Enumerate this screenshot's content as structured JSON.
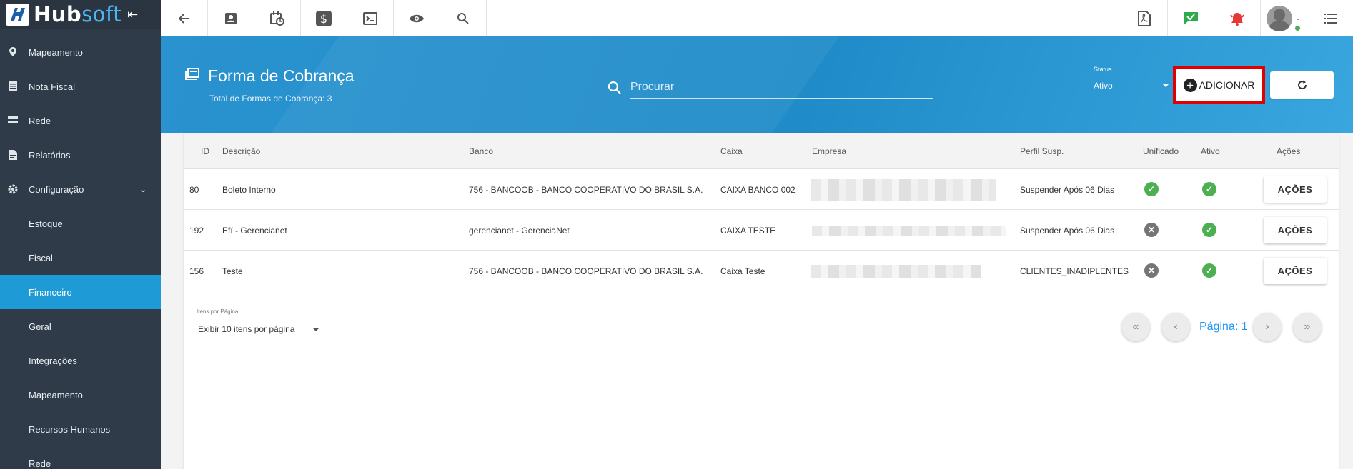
{
  "sidebar": {
    "brand": {
      "hub": "Hub",
      "soft": "soft"
    },
    "items": [
      {
        "label": "Mapeamento",
        "icon": "map-pin-icon"
      },
      {
        "label": "Nota Fiscal",
        "icon": "invoice-icon"
      },
      {
        "label": "Rede",
        "icon": "network-icon"
      },
      {
        "label": "Relatórios",
        "icon": "report-icon"
      },
      {
        "label": "Configuração",
        "icon": "gear-icon"
      },
      {
        "label": "Estoque"
      },
      {
        "label": "Fiscal"
      },
      {
        "label": "Financeiro"
      },
      {
        "label": "Geral"
      },
      {
        "label": "Integrações"
      },
      {
        "label": "Mapeamento"
      },
      {
        "label": "Recursos Humanos"
      },
      {
        "label": "Rede"
      }
    ]
  },
  "header": {
    "title": "Forma de Cobrança",
    "subtitle": "Total de Formas de Cobrança: 3",
    "search_placeholder": "Procurar",
    "status_label": "Status",
    "status_value": "Ativo",
    "add_label": "ADICIONAR"
  },
  "table": {
    "columns": [
      "ID",
      "Descrição",
      "Banco",
      "Caixa",
      "Empresa",
      "Perfil Susp.",
      "Unificado",
      "Ativo",
      "Ações"
    ],
    "rows": [
      {
        "id": "80",
        "descricao": "Boleto Interno",
        "banco": "756 - BANCOOB - BANCO COOPERATIVO DO BRASIL S.A.",
        "caixa": "CAIXA BANCO 002",
        "perfil": "Suspender Após 06 Dias",
        "unificado": true,
        "ativo": true,
        "acoes": "AÇÕES"
      },
      {
        "id": "192",
        "descricao": "Efí - Gerencianet",
        "banco": "gerencianet - GerenciaNet",
        "caixa": "CAIXA TESTE",
        "perfil": "Suspender Após 06 Dias",
        "unificado": false,
        "ativo": true,
        "acoes": "AÇÕES"
      },
      {
        "id": "156",
        "descricao": "Teste",
        "banco": "756 - BANCOOB - BANCO COOPERATIVO DO BRASIL S.A.",
        "caixa": "Caixa Teste",
        "perfil": "CLIENTES_INADIPLENTES",
        "unificado": false,
        "ativo": true,
        "acoes": "AÇÕES"
      }
    ]
  },
  "pagination": {
    "items_label": "Itens por Página",
    "items_value": "Exibir 10 itens por página",
    "page_label": "Página: 1"
  },
  "colors": {
    "accent": "#1e9bd6",
    "sidebar": "#2f3b48",
    "highlight": "#e00000"
  }
}
